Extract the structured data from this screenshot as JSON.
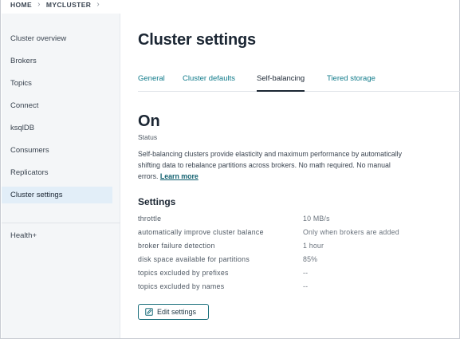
{
  "breadcrumb": {
    "items": [
      "HOME",
      "MYCLUSTER"
    ],
    "separator": "›"
  },
  "sidebar": {
    "items": [
      {
        "label": "Cluster overview"
      },
      {
        "label": "Brokers"
      },
      {
        "label": "Topics"
      },
      {
        "label": "Connect"
      },
      {
        "label": "ksqlDB"
      },
      {
        "label": "Consumers"
      },
      {
        "label": "Replicators"
      },
      {
        "label": "Cluster settings",
        "active": true
      }
    ],
    "health": {
      "label": "Health+"
    }
  },
  "main": {
    "title": "Cluster settings",
    "tabs": [
      {
        "label": "General"
      },
      {
        "label": "Cluster defaults"
      },
      {
        "label": "Self-balancing",
        "active": true
      },
      {
        "label": "Tiered storage"
      }
    ],
    "status": {
      "value": "On",
      "label": "Status"
    },
    "description": {
      "text": "Self-balancing clusters provide elasticity and maximum performance by automatically shifting data to rebalance partitions across brokers. No math required. No manual errors.",
      "link_label": "Learn more"
    },
    "settings": {
      "heading": "Settings",
      "rows": [
        {
          "name": "throttle",
          "value": "10 MB/s"
        },
        {
          "name": "automatically improve cluster balance",
          "value": "Only when brokers are added"
        },
        {
          "name": "broker failure detection",
          "value": "1 hour"
        },
        {
          "name": "disk space available for partitions",
          "value": "85%"
        },
        {
          "name": "topics excluded by prefixes",
          "value": "--"
        },
        {
          "name": "topics excluded by names",
          "value": "--"
        }
      ]
    },
    "edit_button": {
      "label": "Edit settings",
      "icon": "edit-icon"
    }
  },
  "colors": {
    "accent": "#0f7a8a",
    "active_sidebar": "#e2eef8",
    "sidebar_bg": "#f4f6f8",
    "text": "#1b2633"
  }
}
